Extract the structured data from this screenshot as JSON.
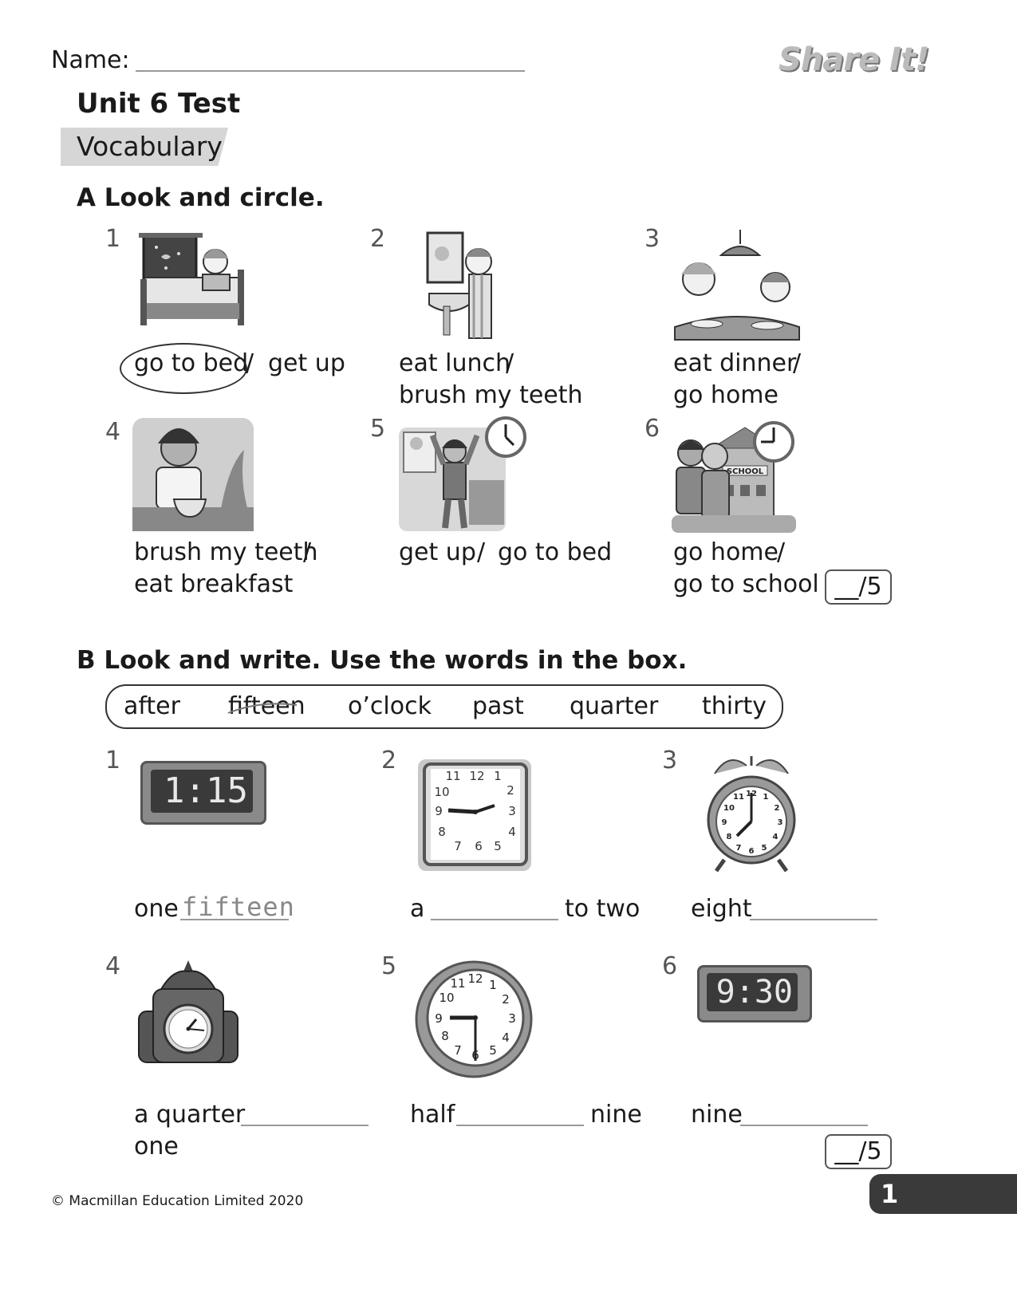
{
  "header": {
    "name_label": "Name:",
    "logo": "Share It!"
  },
  "title": "Unit 6 Test",
  "section_label": "Vocabulary",
  "part_a": {
    "heading": "A  Look and circle.",
    "items": [
      {
        "num": "1",
        "opt1": "go to bed",
        "sep": "/",
        "opt2": "get up",
        "circled": "opt1"
      },
      {
        "num": "2",
        "opt1": "eat lunch",
        "sep": "/",
        "opt2": "brush my teeth"
      },
      {
        "num": "3",
        "opt1": "eat dinner",
        "sep": "/",
        "opt2": "go home"
      },
      {
        "num": "4",
        "opt1": "brush my teeth",
        "sep": "/",
        "opt2": "eat breakfast"
      },
      {
        "num": "5",
        "opt1": "get up",
        "sep": "/",
        "opt2": "go to bed"
      },
      {
        "num": "6",
        "opt1": "go home",
        "sep": "/",
        "opt2": "go to school"
      }
    ],
    "score": "__/5"
  },
  "part_b": {
    "heading": "B  Look and write. Use the words in the box.",
    "word_box": [
      "after",
      "fifteen",
      "o’clock",
      "past",
      "quarter",
      "thirty"
    ],
    "crossed_word_index": 1,
    "items": [
      {
        "num": "1",
        "before": "one",
        "answer": "fifteen",
        "after": "",
        "clock": "digital",
        "display": "1:15"
      },
      {
        "num": "2",
        "before": "a",
        "answer": "",
        "after": "to two",
        "clock": "square-analog"
      },
      {
        "num": "3",
        "before": "eight",
        "answer": "",
        "after": "",
        "clock": "alarm"
      },
      {
        "num": "4",
        "before": "a quarter",
        "answer": "",
        "after": "one",
        "clock": "mantel"
      },
      {
        "num": "5",
        "before": "half",
        "answer": "",
        "after": "nine",
        "clock": "wall-analog"
      },
      {
        "num": "6",
        "before": "nine",
        "answer": "",
        "after": "",
        "clock": "digital",
        "display": "9:30"
      }
    ],
    "score": "__/5"
  },
  "footer": {
    "copyright": "© Macmillan Education Limited 2020",
    "page_number": "1"
  }
}
